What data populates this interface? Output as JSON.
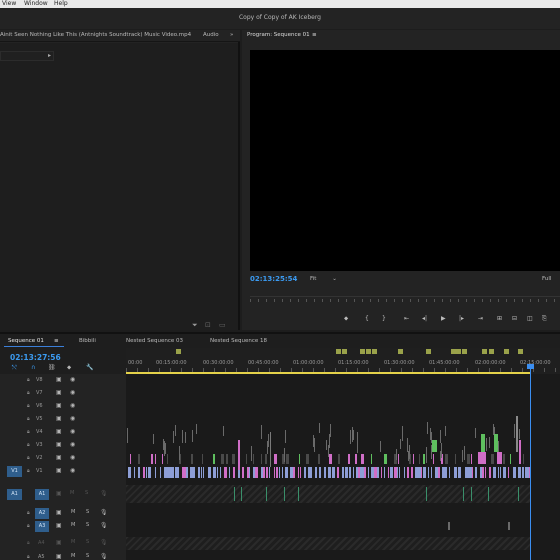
{
  "menu": {
    "view": "View",
    "window": "Window",
    "help": "Help"
  },
  "window_title": "Copy of Copy of AK Iceberg",
  "source_panel": {
    "tab_title": "Ainit Seen Nothing Like This (Antnights Soundtrack) Music Video.mp4",
    "audio_tab": "Audio",
    "expand_glyph": "»"
  },
  "program_monitor": {
    "tab_title": "Program: Sequence 01",
    "menu_glyph": "≡",
    "timecode": "02:13:25:54",
    "fit_label": "Fit",
    "full_label": "Full",
    "controls": [
      "⬥",
      "{",
      "}",
      "⇤",
      "◂|",
      "▶",
      "|▸",
      "⇥",
      "⊞",
      "⊟",
      "◫",
      "⎘"
    ]
  },
  "timeline": {
    "tabs": [
      "Sequence 01",
      "Bibbili",
      "Nested Sequence 03",
      "Nested Sequence 18"
    ],
    "menu_glyph": "≡",
    "timecode": "02:13:27:56",
    "ruler_ticks": [
      "00:00",
      "00:15:00:00",
      "00:30:00:00",
      "00:45:00:00",
      "01:00:00:00",
      "01:15:00:00",
      "01:30:00:00",
      "01:45:00:00",
      "02:00:00:00",
      "02:15:00:00"
    ],
    "video_tracks": [
      "V8",
      "V7",
      "V6",
      "V5",
      "V4",
      "V3",
      "V2",
      "V1"
    ],
    "audio_tracks": [
      "A1",
      "A2",
      "A3",
      "A4",
      "A5"
    ],
    "source_video_patch": "V1",
    "source_audio_patch": "A1",
    "mute_label": "M",
    "solo_label": "S",
    "colors": {
      "accent": "#3b9af0",
      "video_clip": "#8d9ed6",
      "pink_clip": "#d06ec7",
      "green_clip": "#5fbf5f",
      "work_area": "#e4d24a"
    }
  }
}
